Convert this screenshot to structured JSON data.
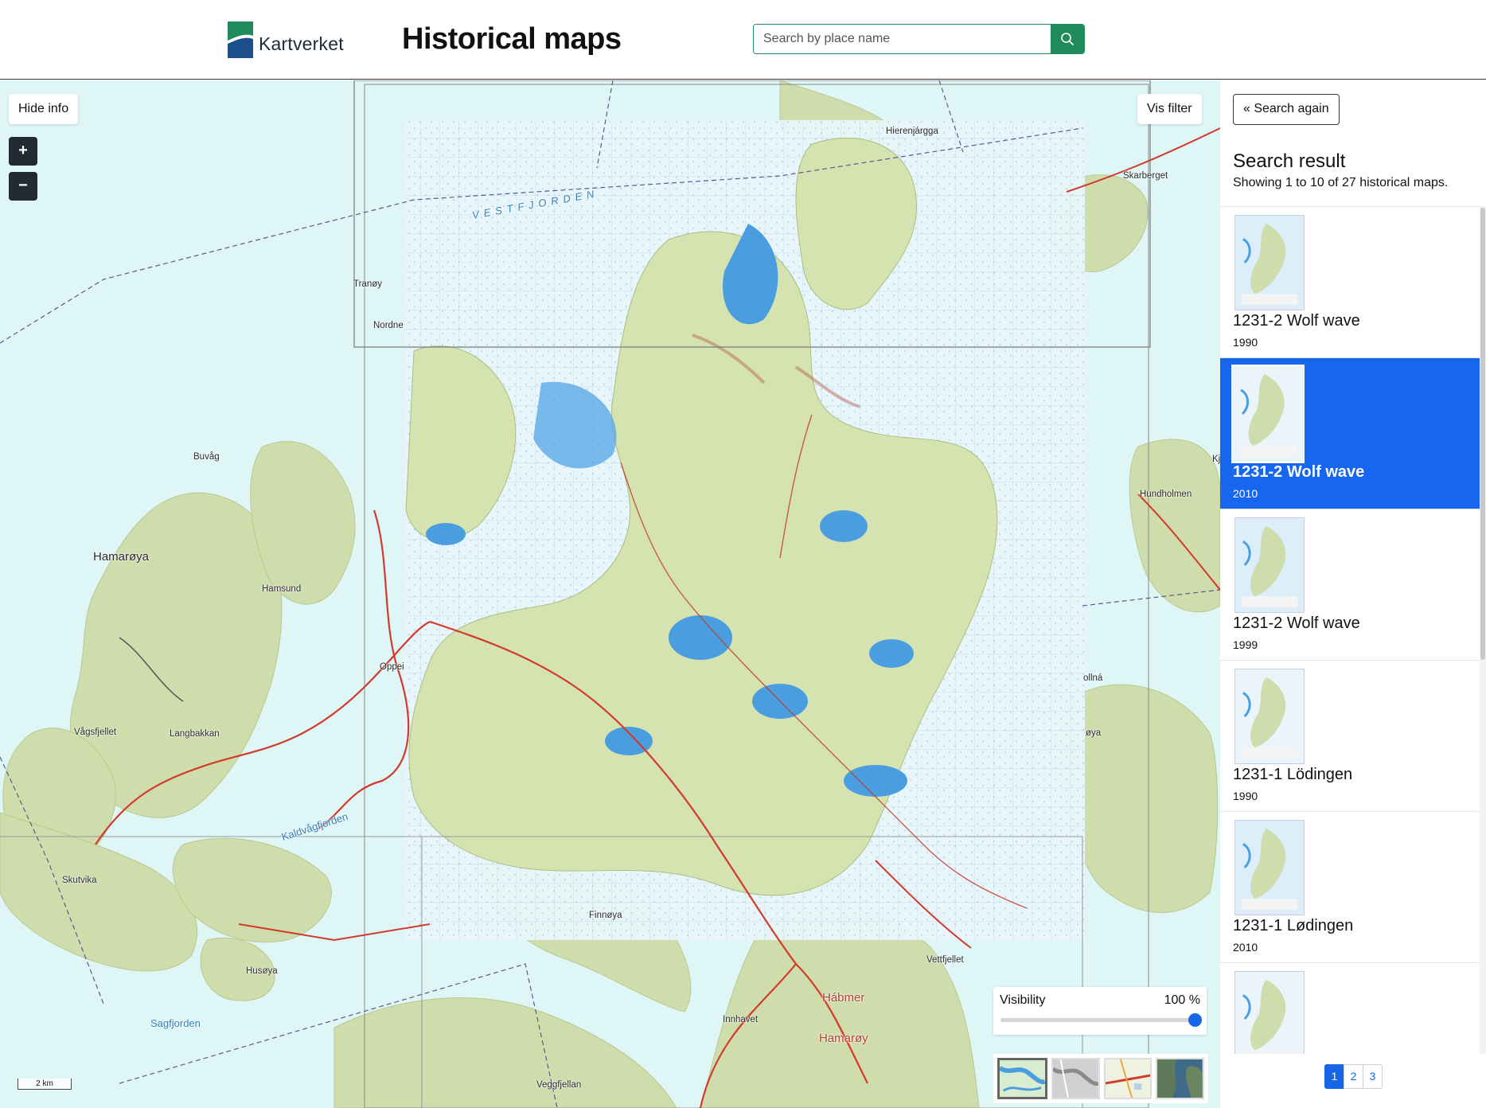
{
  "header": {
    "brand": "Kartverket",
    "title": "Historical maps",
    "search_placeholder": "Search by place name"
  },
  "map": {
    "hide_info_label": "Hide info",
    "filter_label": "Vis filter",
    "zoom_in_label": "+",
    "zoom_out_label": "−",
    "scale_label": "2 km",
    "visibility_label": "Visibility",
    "visibility_value": "100 %",
    "visibility_fraction": 1.0,
    "places": [
      {
        "id": "tranoy",
        "label": "Tranøy"
      },
      {
        "id": "nordne",
        "label": "Nordne"
      },
      {
        "id": "buvag",
        "label": "Buvåg"
      },
      {
        "id": "hamaroya-west",
        "label": "Hamarøya"
      },
      {
        "id": "hamsund",
        "label": "Hamsund"
      },
      {
        "id": "oppei",
        "label": "Oppei"
      },
      {
        "id": "vagsfjellet",
        "label": "Vågsfjellet"
      },
      {
        "id": "langbakkan",
        "label": "Langbakkan"
      },
      {
        "id": "skutvika",
        "label": "Skutvika"
      },
      {
        "id": "kaldvagfjorden",
        "label": "Kaldvågfjorden"
      },
      {
        "id": "finnoya",
        "label": "Finnøya"
      },
      {
        "id": "husoya",
        "label": "Husøya"
      },
      {
        "id": "sagfjorden",
        "label": "Sagfjorden"
      },
      {
        "id": "innhavet",
        "label": "Innhavet"
      },
      {
        "id": "habmer",
        "label": "Hábmer"
      },
      {
        "id": "hamaroy",
        "label": "Hamarøy"
      },
      {
        "id": "vettfjellet",
        "label": "Vettfjellet"
      },
      {
        "id": "veggfjellan",
        "label": "Veggfjellan"
      },
      {
        "id": "hierenjargga",
        "label": "Hierenjárgga"
      },
      {
        "id": "skarberget",
        "label": "Skarberget"
      },
      {
        "id": "hundholmen",
        "label": "Hundholmen"
      },
      {
        "id": "kj",
        "label": "Kj"
      },
      {
        "id": "ollna",
        "label": "ollná"
      },
      {
        "id": "oya",
        "label": "øya"
      },
      {
        "id": "vestfjorden",
        "label": "VESTFJORDEN"
      }
    ]
  },
  "sidebar": {
    "search_again_label": "« Search again",
    "result_title": "Search result",
    "result_subtitle": "Showing 1 to 10 of 27 historical maps.",
    "results": [
      {
        "name": "1231-2 Wolf wave",
        "year": "1990",
        "selected": false
      },
      {
        "name": "1231-2 Wolf wave",
        "year": "2010",
        "selected": true
      },
      {
        "name": "1231-2 Wolf wave",
        "year": "1999",
        "selected": false
      },
      {
        "name": "1231-1 Lödingen",
        "year": "1990",
        "selected": false
      },
      {
        "name": "1231-1 Lødingen",
        "year": "2010",
        "selected": false
      },
      {
        "name": "",
        "year": "",
        "selected": false
      }
    ],
    "pages": [
      "1",
      "2",
      "3"
    ],
    "active_page": "1"
  },
  "colors": {
    "brand_green": "#1f8a5a",
    "selected_blue": "#1666f0",
    "road_red": "#d23a2b",
    "land_green": "#cfdcab",
    "water": "#dff6f7"
  }
}
